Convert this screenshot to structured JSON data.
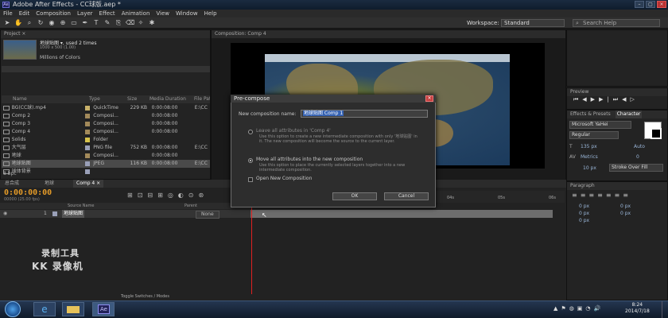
{
  "window": {
    "title": "Adobe After Effects - CC球版.aep *"
  },
  "menu": [
    "File",
    "Edit",
    "Composition",
    "Layer",
    "Effect",
    "Animation",
    "View",
    "Window",
    "Help"
  ],
  "toolbar": {
    "workspace_label": "Workspace:",
    "workspace_value": "Standard",
    "search_placeholder": "Search Help"
  },
  "project": {
    "tab": "Project ×",
    "selected_name": "地球贴图 ▾, used 2 times",
    "selected_size": "1000 x 500 (1.00)",
    "selected_colors": "Millions of Colors",
    "columns": [
      "Name",
      "Type",
      "Size",
      "Media Duration",
      "File Path"
    ],
    "rows": [
      {
        "name": "BG(CC球).mp4",
        "type": "QuickTime",
        "size": "229 KB",
        "dur": "0:00:08:00",
        "path": "E:\\CC",
        "color": "#c8b16a"
      },
      {
        "name": "Comp 2",
        "type": "Composi...",
        "size": "",
        "dur": "0:00:08:00",
        "path": "",
        "color": "#a38a5a"
      },
      {
        "name": "Comp 3",
        "type": "Composi...",
        "size": "",
        "dur": "0:00:08:00",
        "path": "",
        "color": "#a38a5a"
      },
      {
        "name": "Comp 4",
        "type": "Composi...",
        "size": "",
        "dur": "0:00:08:00",
        "path": "",
        "color": "#a38a5a"
      },
      {
        "name": "Solids",
        "type": "Folder",
        "size": "",
        "dur": "",
        "path": "",
        "color": "#d6c24c"
      },
      {
        "name": "大气层",
        "type": "PNG file",
        "size": "752 KB",
        "dur": "0:00:08:00",
        "path": "E:\\CC",
        "color": "#9aa0b8"
      },
      {
        "name": "地球",
        "type": "Composi...",
        "size": "",
        "dur": "0:00:08:00",
        "path": "",
        "color": "#a38a5a"
      },
      {
        "name": "地球贴图",
        "type": "JPEG",
        "size": "116 KB",
        "dur": "0:00:08:00",
        "path": "E:\\CC",
        "color": "#9aa0b8"
      },
      {
        "name": "球体背景",
        "type": "",
        "size": "",
        "dur": "",
        "path": "",
        "color": "#9aa0b8"
      }
    ],
    "bpc": "8 bpc"
  },
  "viewer": {
    "tab": "Composition: Comp 4"
  },
  "dialog": {
    "title": "Pre-compose",
    "name_label": "New composition name:",
    "name_value": "地球贴图 Comp 1",
    "opt1_label": "Leave all attributes in 'Comp 4'",
    "opt1_desc1": "Use this option to create a new intermediate composition with only '地球贴图' in",
    "opt1_desc2": "it. The new composition will become the source to the current layer.",
    "opt2_label": "Move all attributes into the new composition",
    "opt2_desc1": "Use this option to place the currently selected layers together into a new",
    "opt2_desc2": "intermediate composition.",
    "open_label": "Open New Composition",
    "ok": "OK",
    "cancel": "Cancel"
  },
  "timeline": {
    "tabs": [
      "总合成",
      "地球",
      "Comp 4 ×"
    ],
    "active_tab": 2,
    "timecode": "0:00:00:00",
    "fps": "00000 (25.00 fps)",
    "columns": {
      "source": "Source Name",
      "parent": "Parent"
    },
    "layer": {
      "num": "1",
      "name": "地球贴图",
      "parent": "None"
    },
    "ruler": [
      "04s",
      "05s",
      "06s"
    ],
    "toggle": "Toggle Switches / Modes"
  },
  "right": {
    "preview_tab": "Preview",
    "effects_tab": "Effects & Presets",
    "character_tab": "Character",
    "font": "Microsoft YaHei",
    "style": "Regular",
    "size": "135 px",
    "leading": "Auto",
    "kern": "Metrics",
    "tracking": "0",
    "scale": "10 px",
    "stroke_mode": "Stroke Over Fill",
    "paragraph_tab": "Paragraph",
    "indent_values": [
      "0 px",
      "0 px",
      "0 px",
      "0 px",
      "0 px"
    ]
  },
  "watermark": {
    "line1": "录制工具",
    "line2": "KK 录像机"
  },
  "taskbar": {
    "time": "8:24",
    "date": "2014/7/18",
    "ae_label": "Ae"
  }
}
